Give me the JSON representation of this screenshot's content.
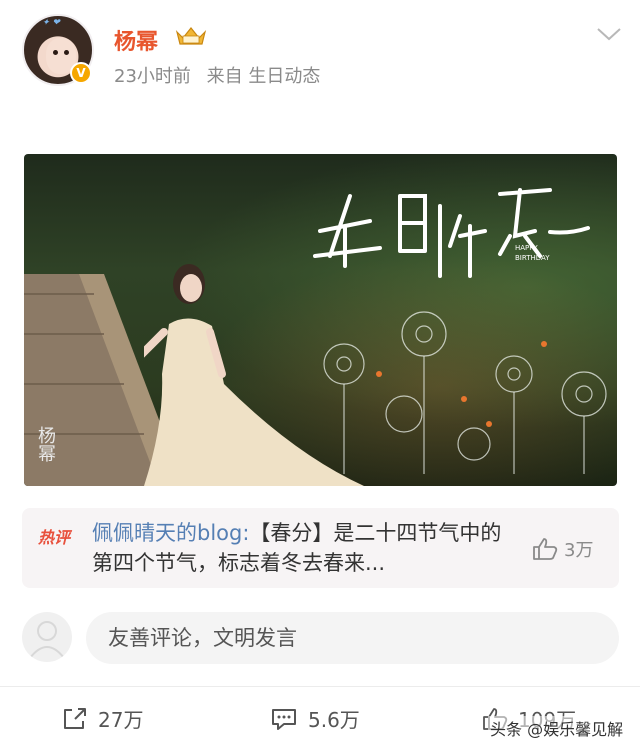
{
  "post": {
    "username": "杨幂",
    "time": "23小时前",
    "source": "来自 生日动态",
    "verify_mark": "V"
  },
  "photo": {
    "signature": "杨幂"
  },
  "hot_comment": {
    "tag": "热评",
    "user": "佩佩晴天的blog:",
    "text": "【春分】是二十四节气中的第四个节气，标志着冬去春来...",
    "likes": "3万"
  },
  "comment": {
    "placeholder": "友善评论，文明发言"
  },
  "actions": {
    "repost": "27万",
    "comment": "5.6万",
    "like": "109万"
  },
  "watermark": "头条 @娱乐馨见解",
  "colors": {
    "username": "#e8562e",
    "hot_tag": "#e8503c",
    "link": "#557fb4",
    "verify": "#f6a700"
  }
}
